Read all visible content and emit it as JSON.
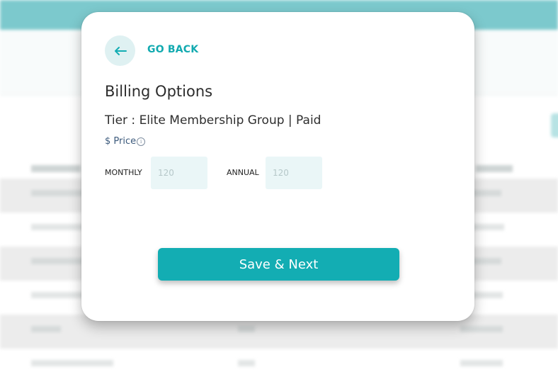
{
  "modal": {
    "go_back_label": "GO BACK",
    "title": "Billing Options",
    "tier_text": "Tier : Elite Membership Group | Paid",
    "price_label": "$ Price",
    "monthly": {
      "label": "MONTHLY",
      "placeholder": "120"
    },
    "annual": {
      "label": "ANNUAL",
      "placeholder": "120"
    },
    "save_label": "Save & Next"
  },
  "icons": {
    "back": "arrow-left-icon",
    "info": "info-icon"
  },
  "colors": {
    "accent": "#13adb3",
    "header": "#7cc9cd",
    "back_button_bg": "#dff1f2",
    "field_bg": "#eaf6f7",
    "price_text": "#3c5a7c"
  }
}
